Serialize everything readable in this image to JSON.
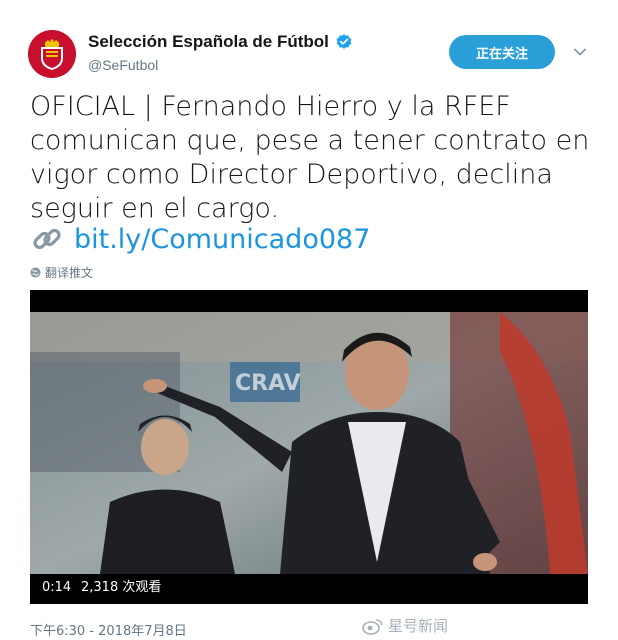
{
  "account": {
    "display_name": "Selección Española de Fútbol",
    "handle": "@SeFutbol",
    "verified": true
  },
  "follow_button": {
    "label": "正在关注"
  },
  "tweet": {
    "text": "OFICIAL | Fernando Hierro y la RFEF comunican que, pese a tener contrato en vigor como Director Deportivo, declina seguir en el cargo.",
    "link_text": "bit.ly/Comunicado087",
    "translate_label": "翻译推文"
  },
  "video": {
    "duration": "0:14",
    "views": "2,318 次观看"
  },
  "timestamp": "下午6:30 - 2018年7月8日",
  "watermark": "星号新闻",
  "colors": {
    "accent": "#1b95e0",
    "follow_bg": "#2a9fd8",
    "secondary_text": "#657786",
    "crest_red": "#c8102e"
  },
  "icons": {
    "verified": "verified-badge-icon",
    "chevron": "chevron-down-icon",
    "link": "link-icon",
    "translate": "globe-icon"
  }
}
